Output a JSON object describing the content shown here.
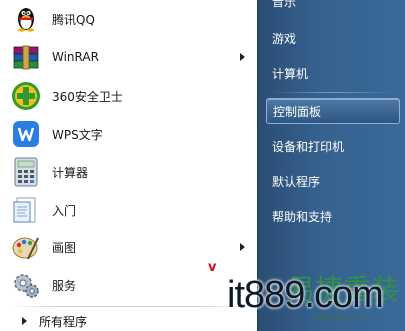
{
  "programs": [
    {
      "label": "腾讯QQ",
      "icon": "qq-penguin-icon",
      "has_submenu": false
    },
    {
      "label": "WinRAR",
      "icon": "winrar-books-icon",
      "has_submenu": true
    },
    {
      "label": "360安全卫士",
      "icon": "360-security-icon",
      "has_submenu": false
    },
    {
      "label": "WPS文字",
      "icon": "wps-writer-icon",
      "has_submenu": false
    },
    {
      "label": "计算器",
      "icon": "calculator-icon",
      "has_submenu": false
    },
    {
      "label": "入门",
      "icon": "getting-started-icon",
      "has_submenu": false
    },
    {
      "label": "画图",
      "icon": "paint-icon",
      "has_submenu": true
    },
    {
      "label": "服务",
      "icon": "services-gears-icon",
      "has_submenu": false
    }
  ],
  "all_programs": {
    "label": "所有程序"
  },
  "right": {
    "items": [
      {
        "label": "音乐"
      },
      {
        "label": "游戏"
      },
      {
        "label": "计算机"
      },
      {
        "label": "控制面板",
        "selected": true
      },
      {
        "label": "设备和打印机"
      },
      {
        "label": "默认程序"
      },
      {
        "label": "帮助和支持"
      }
    ]
  },
  "watermark": {
    "main": "it889.com",
    "cn": "易捷重装",
    "url": "www.yjcz.com"
  },
  "colors": {
    "panel_blue": "#35618e",
    "highlight_border": "#8fb1d4",
    "watermark_green": "#34963c"
  }
}
